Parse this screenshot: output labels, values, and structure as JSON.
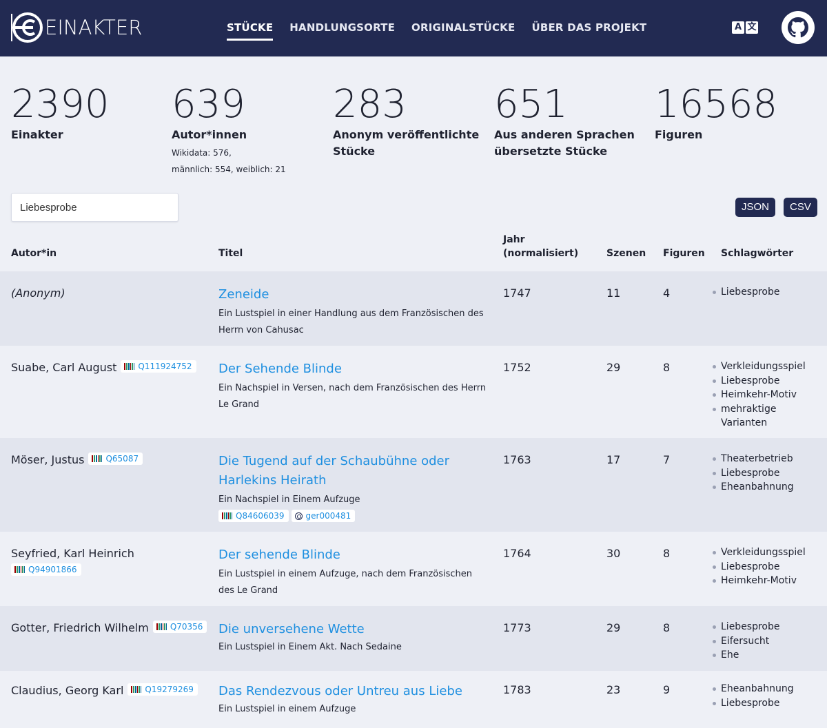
{
  "header": {
    "logo_text": "EINAKTER",
    "nav": [
      "STÜCKE",
      "HANDLUNGSORTE",
      "ORIGINALSTÜCKE",
      "ÜBER DAS PROJEKT"
    ],
    "lang_icon": "translate-icon",
    "github_icon": "github-icon"
  },
  "stats": [
    {
      "num": "2390",
      "label": "Einakter",
      "sub": []
    },
    {
      "num": "639",
      "label": "Autor*innen",
      "sub": [
        "Wikidata: 576,",
        "männlich: 554, weiblich: 21"
      ]
    },
    {
      "num": "283",
      "label": "Anonym veröffentlichte Stücke",
      "sub": []
    },
    {
      "num": "651",
      "label": "Aus anderen Sprachen übersetzte Stücke",
      "sub": []
    },
    {
      "num": "16568",
      "label": "Figuren",
      "sub": []
    }
  ],
  "search": {
    "value": "Liebesprobe"
  },
  "downloads": {
    "json": "JSON",
    "csv": "CSV"
  },
  "table": {
    "headers": {
      "author": "Autor*in",
      "title": "Titel",
      "year": "Jahr (normalisiert)",
      "scenes": "Szenen",
      "figures": "Figuren",
      "tags": "Schlagwörter"
    },
    "rows": [
      {
        "author": "(Anonym)",
        "author_wd": "",
        "title": "Zeneide",
        "subtitle": "Ein Lustspiel in einer Handlung aus dem Französischen des Herrn von Cahusac",
        "play_wd": "",
        "play_dracor": "",
        "year": "1747",
        "scenes": "11",
        "figures": "4",
        "tags": [
          "Liebesprobe"
        ]
      },
      {
        "author": "Suabe, Carl August",
        "author_wd": "Q111924752",
        "title": "Der Sehende Blinde",
        "subtitle": "Ein Nachspiel in Versen, nach dem Französischen des Herrn Le Grand",
        "play_wd": "",
        "play_dracor": "",
        "year": "1752",
        "scenes": "29",
        "figures": "8",
        "tags": [
          "Verkleidungsspiel",
          "Liebesprobe",
          "Heimkehr-Motiv",
          "mehraktige Varianten"
        ]
      },
      {
        "author": "Möser, Justus",
        "author_wd": "Q65087",
        "title": "Die Tugend auf der Schaubühne oder Harlekins Heirath",
        "subtitle": "Ein Nachspiel in Einem Aufzuge",
        "play_wd": "Q84606039",
        "play_dracor": "ger000481",
        "year": "1763",
        "scenes": "17",
        "figures": "7",
        "tags": [
          "Theaterbetrieb",
          "Liebesprobe",
          "Eheanbahnung"
        ]
      },
      {
        "author": "Seyfried, Karl Heinrich",
        "author_wd": "Q94901866",
        "title": "Der sehende Blinde",
        "subtitle": "Ein Lustspiel in einem Aufzuge, nach dem Französischen des Le Grand",
        "play_wd": "",
        "play_dracor": "",
        "year": "1764",
        "scenes": "30",
        "figures": "8",
        "tags": [
          "Verkleidungsspiel",
          "Liebesprobe",
          "Heimkehr-Motiv"
        ]
      },
      {
        "author": "Gotter, Friedrich Wilhelm",
        "author_wd": "Q70356",
        "title": "Die unversehene Wette",
        "subtitle": "Ein Lustspiel in Einem Akt. Nach Sedaine",
        "play_wd": "",
        "play_dracor": "",
        "year": "1773",
        "scenes": "29",
        "figures": "8",
        "tags": [
          "Liebesprobe",
          "Eifersucht",
          "Ehe"
        ]
      },
      {
        "author": "Claudius, Georg Karl",
        "author_wd": "Q19279269",
        "title": "Das Rendezvous oder Untreu aus Liebe",
        "subtitle": "Ein Lustspiel in einem Aufzuge",
        "play_wd": "",
        "play_dracor": "",
        "year": "1783",
        "scenes": "23",
        "figures": "9",
        "tags": [
          "Eheanbahnung",
          "Liebesprobe"
        ]
      }
    ]
  }
}
